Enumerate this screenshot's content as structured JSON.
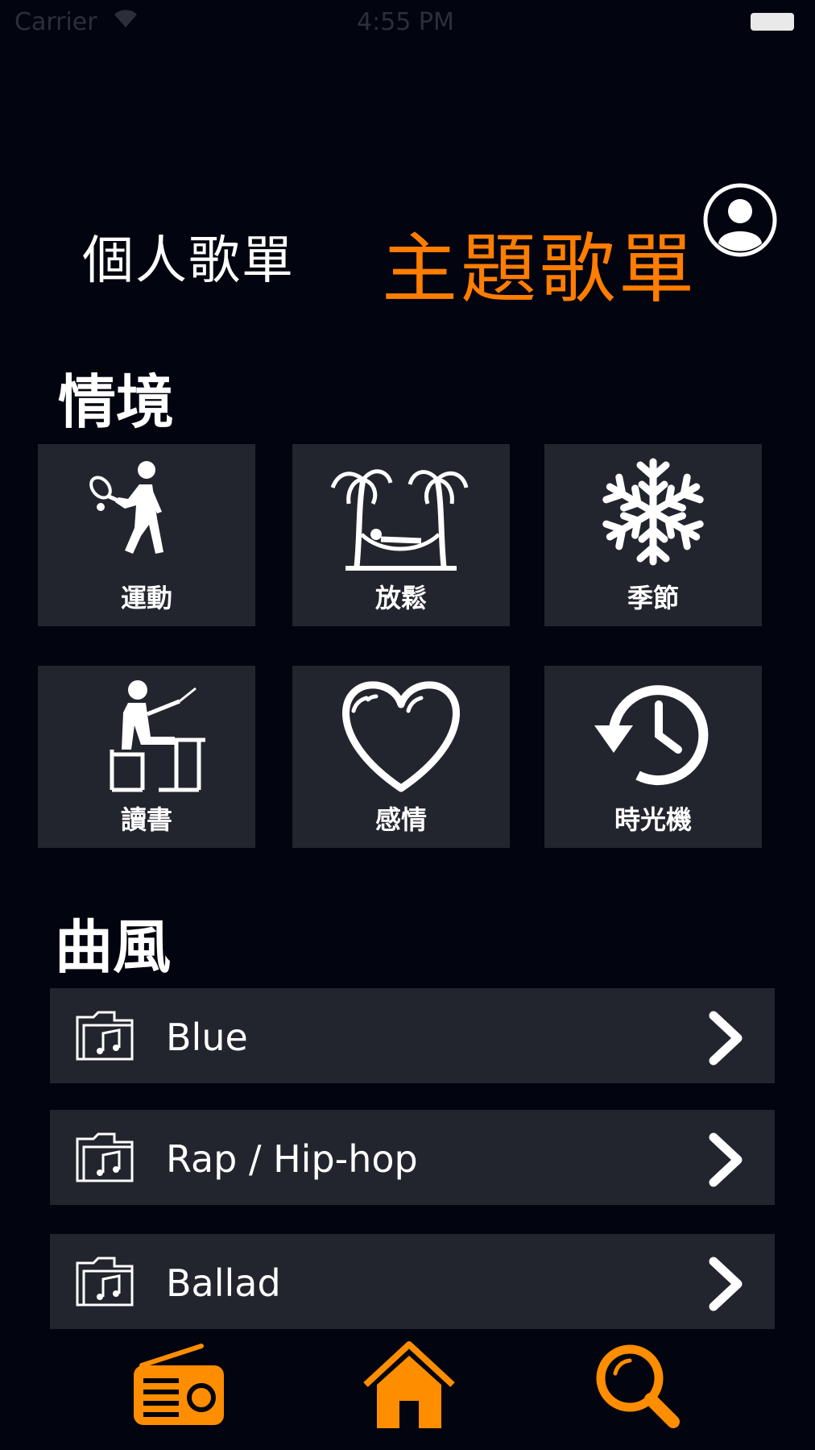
{
  "status_bar": {
    "carrier": "Carrier",
    "time": "4:55 PM"
  },
  "header": {
    "tab_personal": "個人歌單",
    "tab_theme": "主題歌單"
  },
  "sections": {
    "scenario_title": "情境",
    "genre_title": "曲風"
  },
  "scenario_tiles": [
    {
      "label": "運動",
      "icon": "tennis-player-icon"
    },
    {
      "label": "放鬆",
      "icon": "hammock-palm-icon"
    },
    {
      "label": "季節",
      "icon": "snowflake-icon"
    },
    {
      "label": "讀書",
      "icon": "student-desk-icon"
    },
    {
      "label": "感情",
      "icon": "heart-icon"
    },
    {
      "label": "時光機",
      "icon": "history-clock-icon"
    }
  ],
  "genres": [
    {
      "label": "Blue",
      "icon": "music-folder-icon"
    },
    {
      "label": "Rap / Hip-hop",
      "icon": "music-folder-icon"
    },
    {
      "label": "Ballad",
      "icon": "music-folder-icon"
    }
  ],
  "bottom_nav": [
    "radio-icon",
    "home-icon",
    "search-icon"
  ],
  "colors": {
    "accent": "#ff7d00",
    "background": "#02040f",
    "tile": "#23252e"
  }
}
